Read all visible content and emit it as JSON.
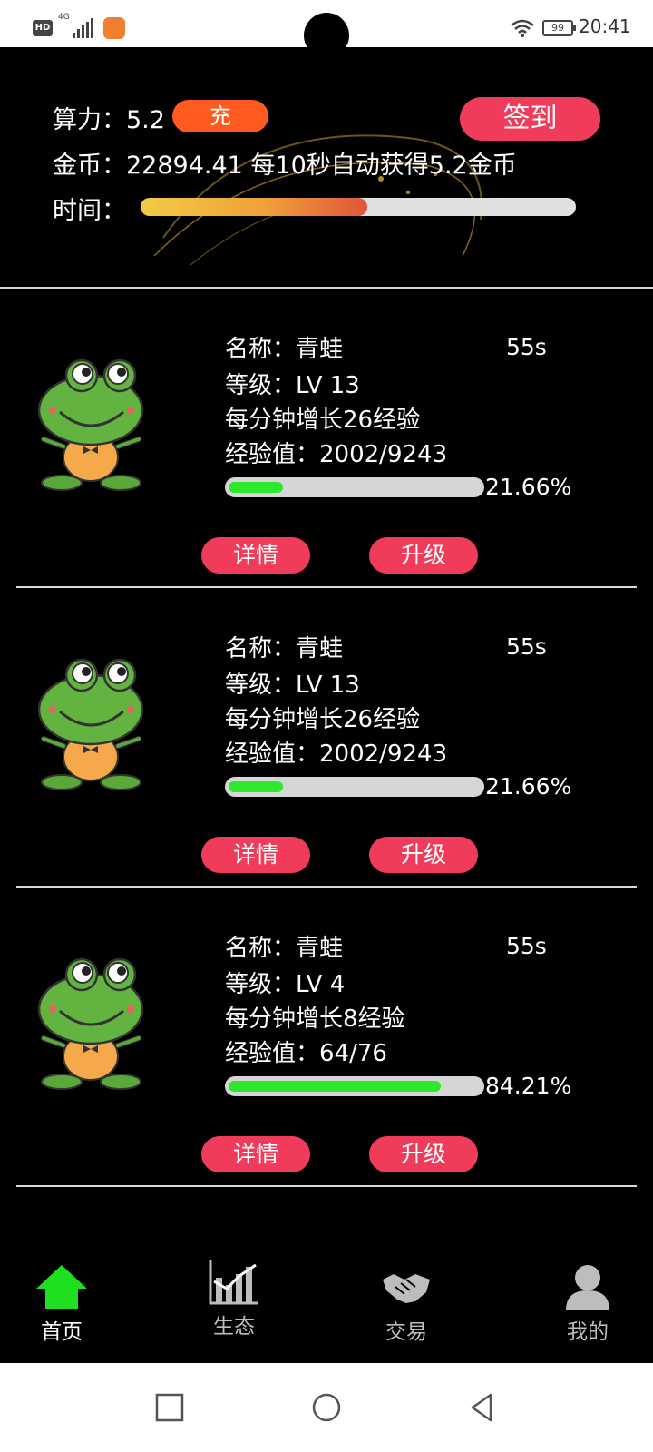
{
  "status_bar": {
    "hd": "HD",
    "network": "4G",
    "battery": "99",
    "time": "20:41"
  },
  "header": {
    "power_label": "算力：",
    "power_value": "5.2",
    "charge_label": "充",
    "signin_label": "签到",
    "coins_label": "金币：",
    "coins_value": "22894.41",
    "coins_rate_text": "每10秒自动获得5.2金币",
    "time_label": "时间：",
    "time_progress_fraction": 0.52
  },
  "pets": [
    {
      "name_label": "名称：",
      "name": "青蛙",
      "timer": "55s",
      "level_label": "等级：",
      "level": "LV 13",
      "growth_text": "每分钟增长26经验",
      "exp_label": "经验值：",
      "exp": "2002/9243",
      "exp_percent_text": "21.66%",
      "exp_fraction": 0.2166,
      "detail_label": "详情",
      "upgrade_label": "升级"
    },
    {
      "name_label": "名称：",
      "name": "青蛙",
      "timer": "55s",
      "level_label": "等级：",
      "level": "LV 13",
      "growth_text": "每分钟增长26经验",
      "exp_label": "经验值：",
      "exp": "2002/9243",
      "exp_percent_text": "21.66%",
      "exp_fraction": 0.2166,
      "detail_label": "详情",
      "upgrade_label": "升级"
    },
    {
      "name_label": "名称：",
      "name": "青蛙",
      "timer": "55s",
      "level_label": "等级：",
      "level": "LV 4",
      "growth_text": "每分钟增长8经验",
      "exp_label": "经验值：",
      "exp": "64/76",
      "exp_percent_text": "84.21%",
      "exp_fraction": 0.8421,
      "detail_label": "详情",
      "upgrade_label": "升级"
    }
  ],
  "bottom_nav": [
    {
      "label": "首页",
      "icon": "home-icon",
      "active": true
    },
    {
      "label": "生态",
      "icon": "chart-icon",
      "active": false
    },
    {
      "label": "交易",
      "icon": "handshake-icon",
      "active": false
    },
    {
      "label": "我的",
      "icon": "user-icon",
      "active": false
    }
  ],
  "colors": {
    "accent_red": "#f03c5a",
    "charge_orange": "#ff5a1f",
    "progress_green": "#2ee82e",
    "active_nav_green": "#1fe01f"
  }
}
